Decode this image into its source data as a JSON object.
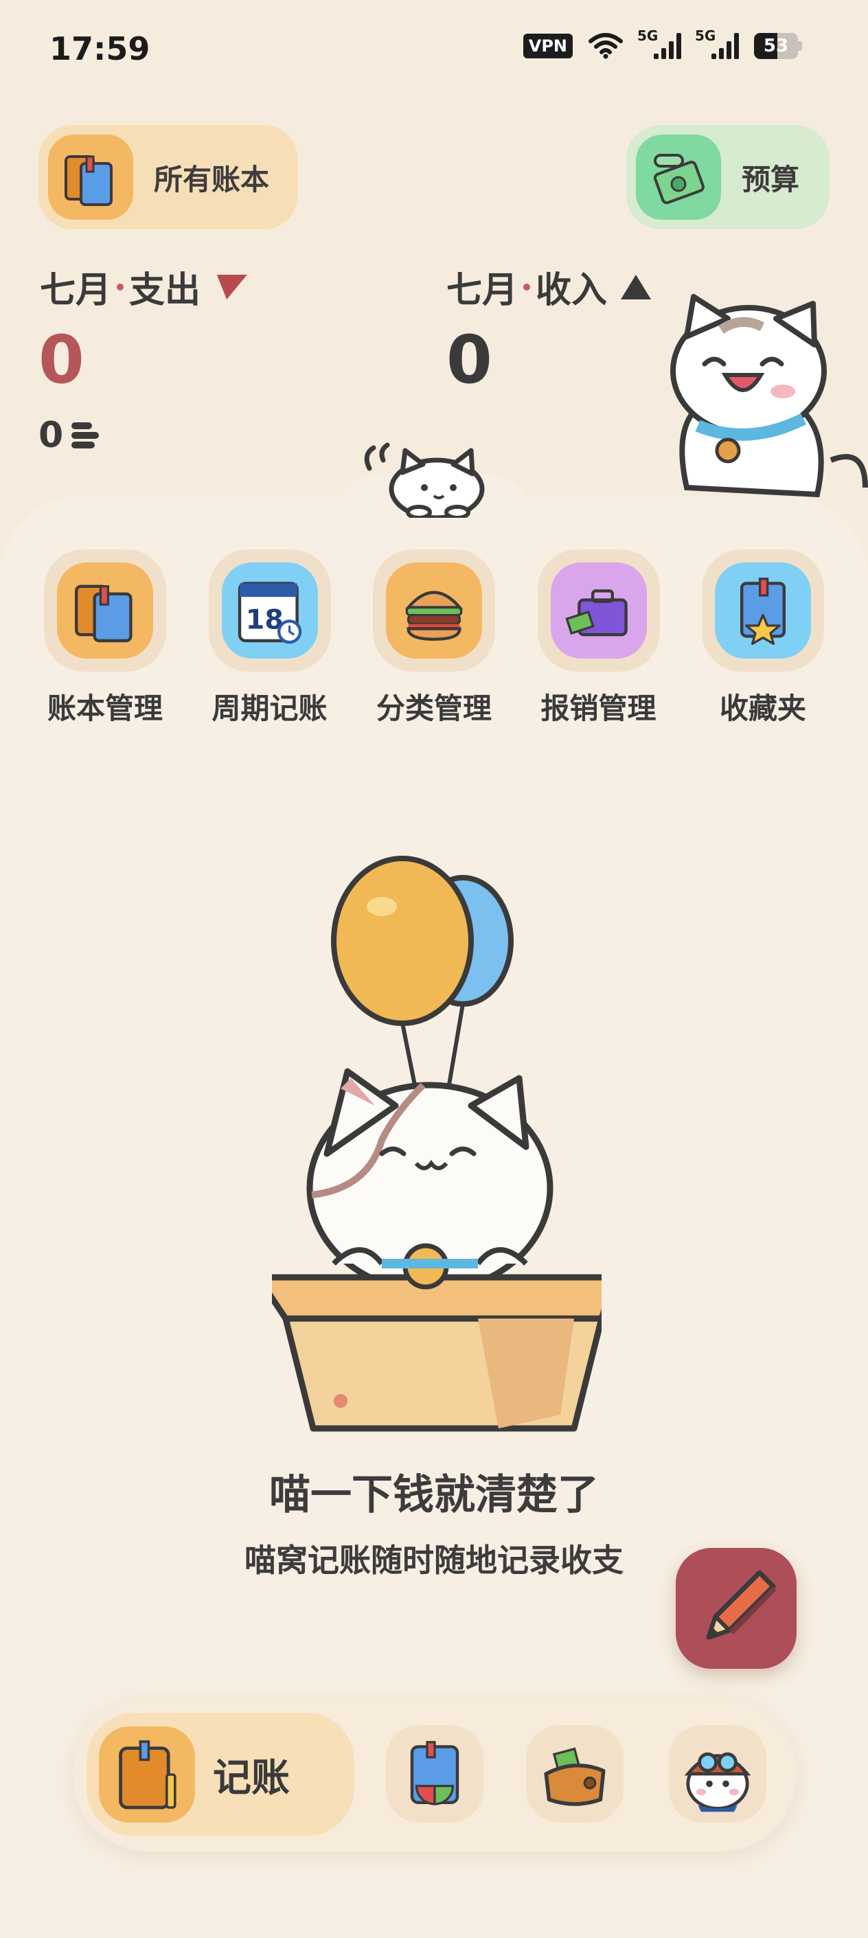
{
  "status_bar": {
    "time": "17:59",
    "vpn": "VPN",
    "signal1": "5G",
    "signal2": "5G",
    "battery": "53"
  },
  "header": {
    "books_label": "所有账本",
    "budget_label": "预算"
  },
  "summary": {
    "expense_month": "七月",
    "expense_label": "支出",
    "expense_value": "0",
    "expense_count": "0",
    "income_month": "七月",
    "income_label": "收入",
    "income_value": "0"
  },
  "shortcuts": [
    {
      "label": "账本管理",
      "icon": "books-icon",
      "color": "#f4b862"
    },
    {
      "label": "周期记账",
      "icon": "calendar-icon",
      "color": "#7fd0f4"
    },
    {
      "label": "分类管理",
      "icon": "burger-icon",
      "color": "#f4b862"
    },
    {
      "label": "报销管理",
      "icon": "briefcase-icon",
      "color": "#d9a6ec"
    },
    {
      "label": "收藏夹",
      "icon": "star-book-icon",
      "color": "#7fd0f4"
    }
  ],
  "empty_state": {
    "title": "喵一下钱就清楚了",
    "subtitle": "喵窝记账随时随地记录收支"
  },
  "bottom_nav": {
    "active_label": "记账",
    "items": [
      "bookkeeping-icon",
      "stats-book-icon",
      "wallet-icon",
      "pilot-cat-icon"
    ]
  },
  "colors": {
    "background": "#f6ecdd",
    "expense": "#b84a4f",
    "fab": "#ad4e58"
  }
}
